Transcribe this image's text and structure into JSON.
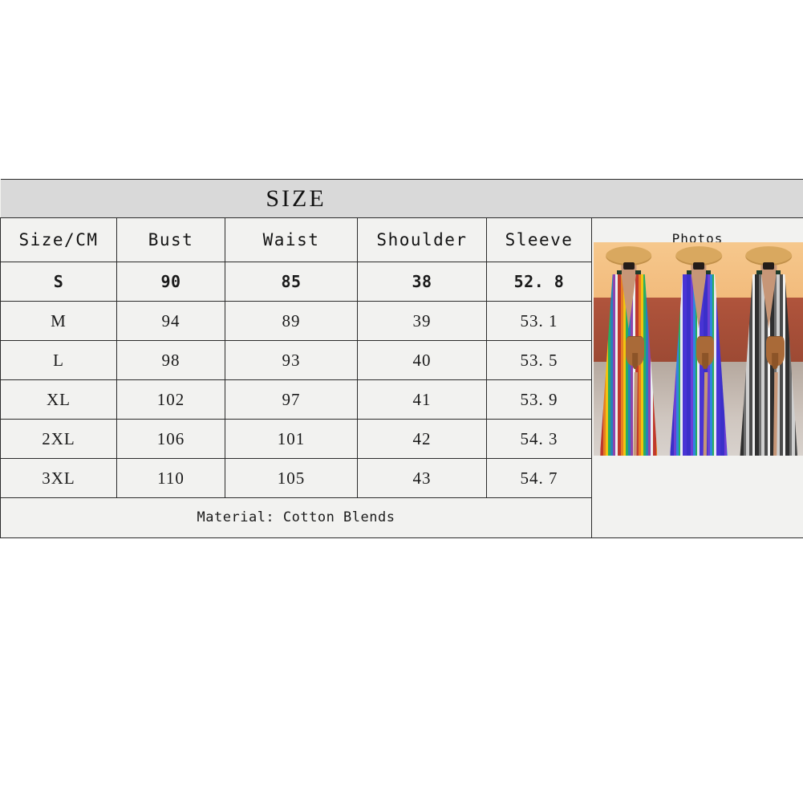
{
  "chart": {
    "title": "SIZE",
    "columns": [
      "Size/CM",
      "Bust",
      "Waist",
      "Shoulder",
      "Sleeve",
      "Photos"
    ],
    "rows": [
      {
        "size": "S",
        "bust": "90",
        "waist": "85",
        "shoulder": "38",
        "sleeve": "52. 8",
        "highlight": true
      },
      {
        "size": "M",
        "bust": "94",
        "waist": "89",
        "shoulder": "39",
        "sleeve": "53. 1",
        "highlight": false
      },
      {
        "size": "L",
        "bust": "98",
        "waist": "93",
        "shoulder": "40",
        "sleeve": "53. 5",
        "highlight": false
      },
      {
        "size": "XL",
        "bust": "102",
        "waist": "97",
        "shoulder": "41",
        "sleeve": "53. 9",
        "highlight": false
      },
      {
        "size": "2XL",
        "bust": "106",
        "waist": "101",
        "shoulder": "42",
        "sleeve": "54. 3",
        "highlight": false
      },
      {
        "size": "3XL",
        "bust": "110",
        "waist": "105",
        "shoulder": "43",
        "sleeve": "54. 7",
        "highlight": false
      }
    ],
    "material": "Material: Cotton Blends",
    "photo": {
      "alt": "three women wearing striped button-front maxi dresses with straw hats and tan crossbody bags",
      "variants": [
        "multicolor-red-stripe",
        "blue-purple-stripe",
        "black-grey-stripe"
      ]
    },
    "colors": {
      "title_band": "#d9d9d9",
      "cell_background": "#f2f2f0",
      "border": "#2b2b2b",
      "text": "#1a1a1a",
      "page_background": "#ffffff"
    }
  }
}
